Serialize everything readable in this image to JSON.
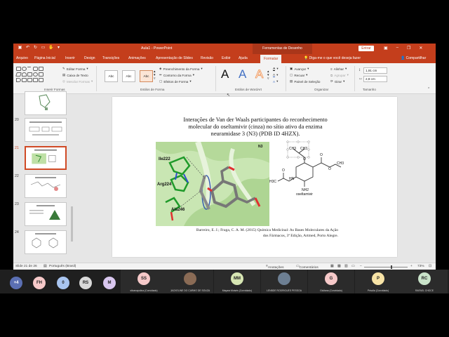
{
  "window": {
    "title": "Aula1 - PowerPoint",
    "context_tab": "Ferramentas de Desenho",
    "sign_in": "Entrar"
  },
  "menu_tabs": [
    "Arquivo",
    "Página Inicial",
    "Inserir",
    "Design",
    "Transições",
    "Animações",
    "Apresentação de Slides",
    "Revisão",
    "Exibir",
    "Ajuda",
    "Formatar"
  ],
  "tell_me": "Diga-me o que você deseja fazer",
  "share": "Compartilhar",
  "ribbon": {
    "insert_shapes": {
      "label": "Inserir Formas",
      "edit_shape": "Editar Forma",
      "text_box": "Caixa de Texto",
      "merge_shapes": "Mesclar Formas"
    },
    "shape_styles": {
      "label": "Estilos de Forma",
      "style_sample": "Abc",
      "fill": "Preenchimento da Forma",
      "outline": "Contorno da Forma",
      "effects": "Efeitos de Forma"
    },
    "wordart": {
      "label": "Estilos de WordArt",
      "letter": "A"
    },
    "arrange": {
      "label": "Organizar",
      "bring_forward": "Avançar",
      "send_backward": "Recuar",
      "selection_pane": "Painel de Seleção",
      "align": "Alinhar",
      "group": "Agrupar",
      "rotate": "Girar"
    },
    "size": {
      "label": "Tamanho",
      "height": "1,91 cm",
      "width": "2,8 cm"
    }
  },
  "thumbnails": [
    {
      "num": "",
      "selected": false
    },
    {
      "num": "20",
      "selected": false
    },
    {
      "num": "21",
      "selected": true
    },
    {
      "num": "22",
      "selected": false
    },
    {
      "num": "23",
      "selected": false
    },
    {
      "num": "24",
      "selected": false
    }
  ],
  "slide": {
    "title_lines": [
      "Interações de Van der Waals participantes do reconhecimento",
      "molecular do oseltamivir (cinza) no sítio ativo da enzima",
      "neuramidase 3 (N3) (PDB ID 4HZX)."
    ],
    "residues": [
      "Ile222",
      "Arg224",
      "Ala246"
    ],
    "protein_label": "N3",
    "structure": {
      "atoms": [
        "CH3",
        "CH3",
        "O",
        "O",
        "O",
        "CH3",
        "HN",
        "NH2"
      ],
      "acetyl": "H3C",
      "name": "oseltamivir"
    },
    "citation_lines": [
      "Barreiro, E. J.; Fraga, C. A. M. (2015) Química Medicinal: As Bases Moleculares da Ação",
      "dos Fármacos, 3ª Edição, Artmed, Porto Alegre."
    ]
  },
  "status_bar": {
    "slide_info": "Slide 21 de 26",
    "language": "Português (Brasil)",
    "notes": "Anotações",
    "comments": "Comentários",
    "zoom": "73%"
  },
  "meeting": {
    "overflow": "+4",
    "small_avatars": [
      {
        "initials": "FH",
        "color": "#f6c9c9"
      },
      {
        "initials": "0",
        "color": "#a9c5f0"
      },
      {
        "initials": "RS",
        "color": "#d9d9d9"
      },
      {
        "initials": "M",
        "color": "#d9c7ef"
      }
    ],
    "participants": [
      {
        "initials": "SS",
        "name": "silvanapolina (Convidado)",
        "color": "#f6c9c9"
      },
      {
        "initials": "",
        "name": "JACKELINE DO CARMO DE SOUZA",
        "color": "#8a6b55"
      },
      {
        "initials": "MM",
        "name": "Mayara Moisés (Convidado)",
        "color": "#d7e6b3"
      },
      {
        "initials": "",
        "name": "LENBDE RODRIGUES PESSOA",
        "color": "#6d7f93"
      },
      {
        "initials": "G",
        "name": "Giuliana (Convidado)",
        "color": "#f6c9c9"
      },
      {
        "initials": "P",
        "name": "Priscila (Convidado)",
        "color": "#f7e3a6"
      },
      {
        "initials": "RC",
        "name": "RAFAEL CHOCE",
        "color": "#c9e3c9"
      }
    ]
  }
}
